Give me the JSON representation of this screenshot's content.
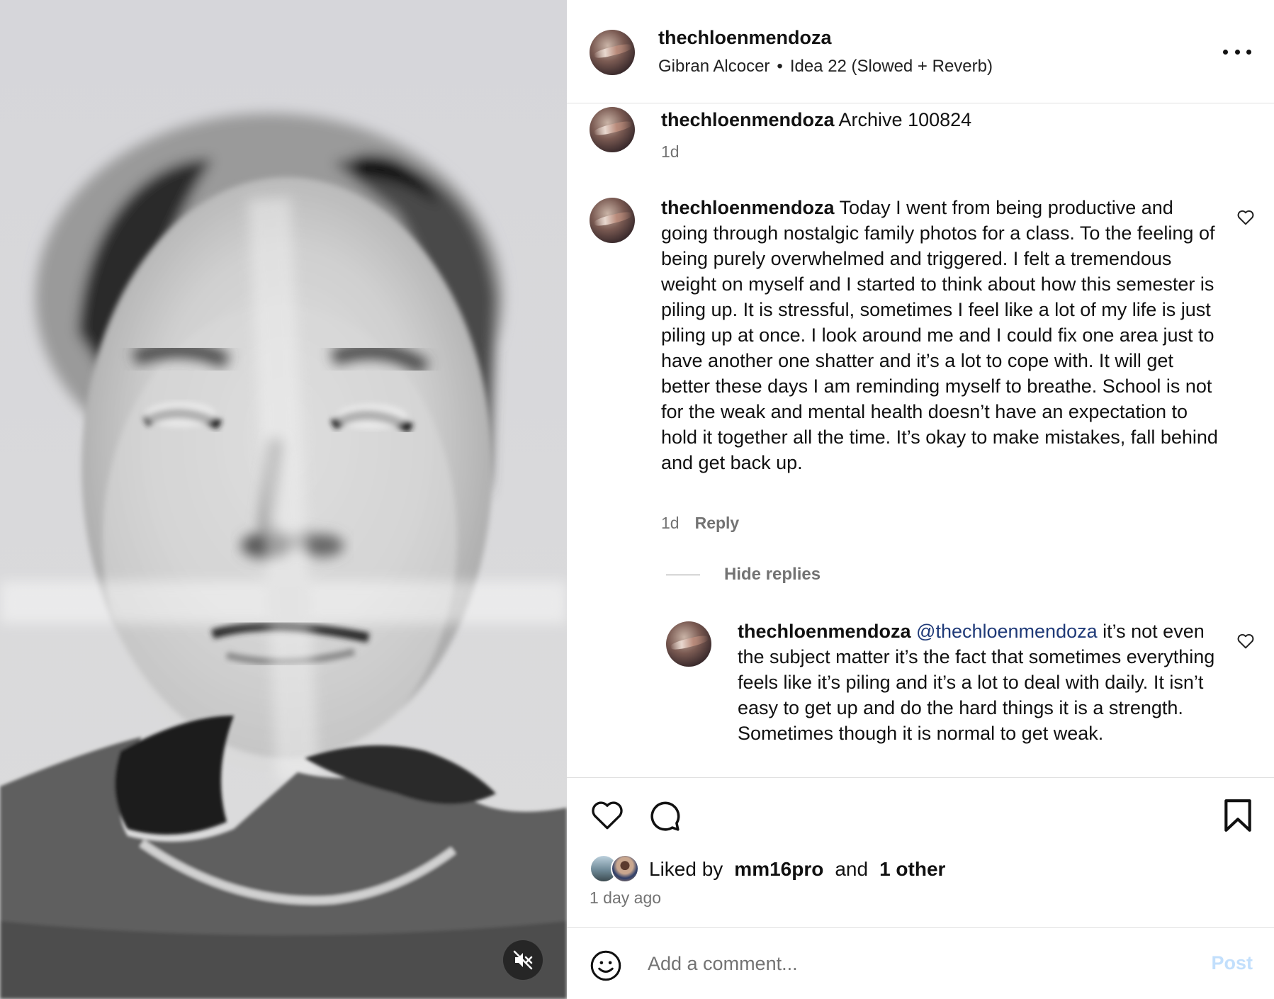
{
  "media": {
    "description_icon": "muted-speaker-icon"
  },
  "header": {
    "username": "thechloenmendoza",
    "audio_artist": "Gibran Alcocer",
    "audio_separator": "•",
    "audio_track": "Idea 22 (Slowed + Reverb)"
  },
  "caption": {
    "username": "thechloenmendoza",
    "text": " Archive 100824",
    "time": "1d"
  },
  "comment1": {
    "username": "thechloenmendoza",
    "text": " Today I went from being productive and going through nostalgic family photos for a class. To the feeling of being purely overwhelmed and triggered. I felt a tremendous weight on myself and I started to think about how this semester is piling up. It is stressful, sometimes I feel like a lot of my life is just piling up at once. I look around me and I could fix one area just to have another one shatter and it’s a lot to cope with. It will get better these days I am reminding myself to breathe. School is not for the weak and mental health doesn’t have an expectation to hold it together all the time. It’s okay to make mistakes, fall behind and get back up.",
    "time": "1d",
    "reply_label": "Reply"
  },
  "hide_replies_label": "Hide replies",
  "reply1": {
    "username": "thechloenmendoza",
    "mention": "@thechloenmendoza",
    "text": " it’s not even the subject matter it’s the fact that sometimes everything feels like it’s piling and it’s a lot to deal with daily. It isn’t easy to get up and do the hard things it is a strength. Sometimes though it is normal to get weak."
  },
  "likes": {
    "prefix": "Liked by",
    "first_liker": "mm16pro",
    "conjunction": "and",
    "others": "1 other",
    "time_ago": "1 day ago"
  },
  "composer": {
    "placeholder": "Add a comment...",
    "post_label": "Post"
  },
  "colors": {
    "mention": "#1f3a78",
    "muted_text": "#737373",
    "post_disabled": "#c2dffc"
  }
}
